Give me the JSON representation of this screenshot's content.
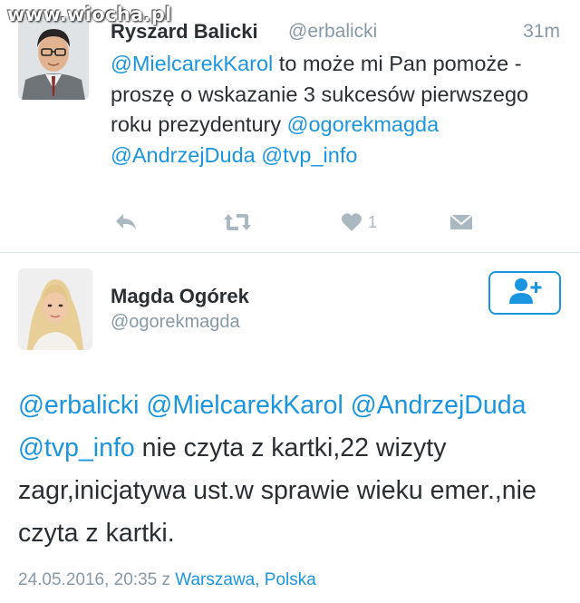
{
  "watermark": "www.wiocha.pl",
  "tweet1": {
    "name": "Ryszard Balicki",
    "handle": "@erbalicki",
    "time": "31m",
    "mention1": "@MielcarekKarol",
    "text1": " to może mi Pan pomoże - proszę o wskazanie 3 sukcesów pierwszego roku prezydentury ",
    "mention2": "@ogorekmagda",
    "mention3": "@AndrzejDuda",
    "mention4": "@tvp_info",
    "like_count": "1",
    "icons": [
      "reply-icon",
      "retweet-icon",
      "heart-icon",
      "direct-message-icon"
    ]
  },
  "tweet2": {
    "name": "Magda Ogórek",
    "handle": "@ogorekmagda",
    "follow_icon": "follow-user-icon",
    "mention1": "@erbalicki",
    "mention2": "@MielcarekKarol",
    "mention3": "@AndrzejDuda",
    "mention4": "@tvp_info",
    "text": " nie czyta z kartki,22 wizyty zagr,inicjatywa ust.w sprawie wieku emer.,nie czyta z kartki.",
    "date": "24.05.2016, 20:35 z ",
    "location": "Warszawa, Polska"
  },
  "colors": {
    "link": "#1b95e0",
    "secondary": "#8899a6",
    "icon": "#aab8c2",
    "text": "#292f33"
  }
}
